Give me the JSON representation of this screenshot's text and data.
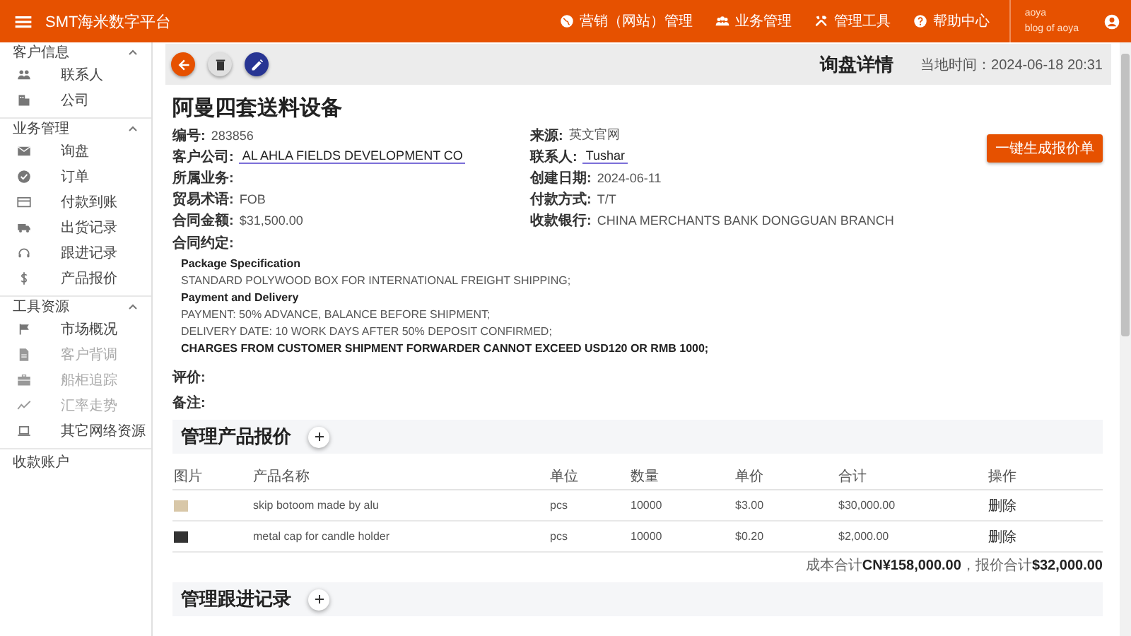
{
  "app_bar": {
    "title": "SMT海米数字平台",
    "nav": [
      {
        "label": "营销（网站）管理"
      },
      {
        "label": "业务管理"
      },
      {
        "label": "管理工具"
      },
      {
        "label": "帮助中心"
      }
    ],
    "user": {
      "name": "aoya",
      "subtitle": "blog of aoya"
    }
  },
  "sidebar": [
    {
      "kind": "group",
      "title": "客户信息",
      "expanded": true,
      "items": [
        {
          "label": "联系人",
          "disabled": false
        },
        {
          "label": "公司",
          "disabled": false
        }
      ]
    },
    {
      "kind": "group",
      "title": "业务管理",
      "expanded": true,
      "items": [
        {
          "label": "询盘",
          "disabled": false
        },
        {
          "label": "订单",
          "disabled": false
        },
        {
          "label": "付款到账",
          "disabled": false
        },
        {
          "label": "出货记录",
          "disabled": false
        },
        {
          "label": "跟进记录",
          "disabled": false
        },
        {
          "label": "产品报价",
          "disabled": false
        }
      ]
    },
    {
      "kind": "group",
      "title": "工具资源",
      "expanded": true,
      "items": [
        {
          "label": "市场概况",
          "disabled": false
        },
        {
          "label": "客户背调",
          "disabled": true
        },
        {
          "label": "船柜追踪",
          "disabled": true
        },
        {
          "label": "汇率走势",
          "disabled": true
        },
        {
          "label": "其它网络资源",
          "disabled": false
        }
      ]
    },
    {
      "kind": "link",
      "title": "收款账户"
    }
  ],
  "toolbar": {
    "heading": "询盘详情",
    "local_time": "当地时间：2024-06-18 20:31"
  },
  "inquiry": {
    "title": "阿曼四套送料设备",
    "action_button": "一键生成报价单",
    "left_fields": [
      {
        "label": "编号:",
        "value": "283856",
        "kind": "text"
      },
      {
        "label": "客户公司:",
        "value": "AL AHLA FIELDS DEVELOPMENT CO",
        "kind": "link"
      },
      {
        "label": "所属业务:"
      },
      {
        "label": "贸易术语:",
        "value": "FOB",
        "kind": "text"
      },
      {
        "label": "合同金额:",
        "value": "$31,500.00",
        "kind": "text"
      }
    ],
    "right_fields": [
      {
        "label": "来源:",
        "value": "英文官网",
        "kind": "text"
      },
      {
        "label": "联系人:",
        "value": "Tushar",
        "kind": "link"
      },
      {
        "label": "创建日期:",
        "value": "2024-06-11",
        "kind": "text"
      },
      {
        "label": "付款方式:",
        "value": "T/T",
        "kind": "text"
      },
      {
        "label": "收款银行:",
        "value": "CHINA MERCHANTS BANK DONGGUAN BRANCH",
        "kind": "text"
      }
    ],
    "contract_label": "合同约定:",
    "contract_lines": [
      {
        "text": "Package Specification",
        "kind": "heading"
      },
      {
        "text": "STANDARD POLYWOOD BOX FOR INTERNATIONAL FREIGHT SHIPPING;",
        "kind": "normal"
      },
      {
        "text": "Payment and Delivery",
        "kind": "heading"
      },
      {
        "text": "PAYMENT: 50% ADVANCE, BALANCE BEFORE SHIPMENT;",
        "kind": "normal"
      },
      {
        "text": "DELIVERY DATE: 10 WORK DAYS AFTER 50% DEPOSIT CONFIRMED;",
        "kind": "normal"
      },
      {
        "text": "CHARGES FROM CUSTOMER SHIPMENT FORWARDER CANNOT EXCEED USD120 OR RMB 1000;",
        "kind": "heading"
      }
    ],
    "rating_label": "评价:",
    "notes_label": "备注:"
  },
  "products": {
    "title": "管理产品报价",
    "columns": [
      "图片",
      "产品名称",
      "单位",
      "数量",
      "单价",
      "合计",
      "操作"
    ],
    "rows": [
      {
        "name": "skip botoom made by alu",
        "unit": "pcs",
        "quantity": "10000",
        "price": "$3.00",
        "total": "$30,000.00",
        "action": "删除"
      },
      {
        "name": "metal cap for candle holder",
        "unit": "pcs",
        "quantity": "10000",
        "price": "$0.20",
        "total": "$2,000.00",
        "action": "删除"
      }
    ],
    "summary": "成本合计**CN¥158,000.00**，报价合计**$32,000.00**"
  },
  "followups": {
    "title": "管理跟进记录"
  }
}
